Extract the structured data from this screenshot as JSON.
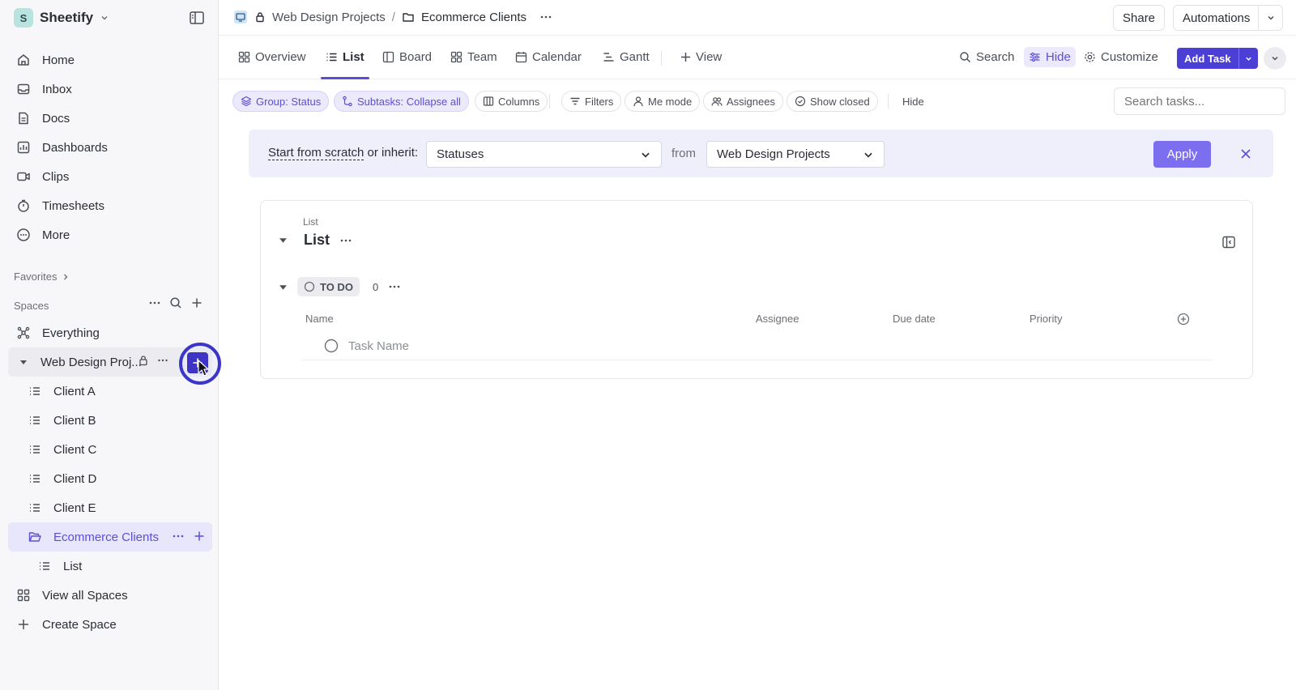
{
  "workspace": {
    "initial": "S",
    "name": "Sheetify"
  },
  "sidebar": {
    "nav": [
      {
        "label": "Home",
        "icon": "home-icon"
      },
      {
        "label": "Inbox",
        "icon": "inbox-icon"
      },
      {
        "label": "Docs",
        "icon": "doc-icon"
      },
      {
        "label": "Dashboards",
        "icon": "dashboard-icon"
      },
      {
        "label": "Clips",
        "icon": "video-icon"
      },
      {
        "label": "Timesheets",
        "icon": "timer-icon"
      },
      {
        "label": "More",
        "icon": "more-icon"
      }
    ],
    "favorites_label": "Favorites",
    "spaces_label": "Spaces",
    "everything_label": "Everything",
    "space_name": "Web Design Proj...",
    "lists": [
      "Client A",
      "Client B",
      "Client C",
      "Client D",
      "Client E"
    ],
    "folder_name": "Ecommerce Clients",
    "folder_list": "List",
    "view_all_spaces": "View all Spaces",
    "create_space": "Create Space"
  },
  "breadcrumb": {
    "space": "Web Design Projects",
    "separator": "/",
    "folder": "Ecommerce Clients"
  },
  "top_actions": {
    "share": "Share",
    "automations": "Automations"
  },
  "tabs": [
    "Overview",
    "List",
    "Board",
    "Team",
    "Calendar",
    "Gantt"
  ],
  "add_view": "View",
  "view_actions": {
    "search": "Search",
    "hide": "Hide",
    "customize": "Customize",
    "add_task": "Add Task"
  },
  "filters": {
    "group": "Group: Status",
    "subtasks": "Subtasks: Collapse all",
    "columns": "Columns",
    "filters": "Filters",
    "me_mode": "Me mode",
    "assignees": "Assignees",
    "show_closed": "Show closed",
    "hide": "Hide",
    "search_placeholder": "Search tasks..."
  },
  "banner": {
    "start_link": "Start from scratch",
    "or_inherit": " or inherit:",
    "statuses_value": "Statuses",
    "from": "from",
    "source_value": "Web Design Projects",
    "apply": "Apply"
  },
  "list_card": {
    "small_label": "List",
    "title": "List",
    "status": "TO DO",
    "count": "0",
    "columns": [
      "Name",
      "Assignee",
      "Due date",
      "Priority"
    ],
    "task_placeholder": "Task Name"
  },
  "colors": {
    "accent": "#5b4fd6",
    "accent_dark": "#3d34c6",
    "banner_bg": "#efeefb"
  }
}
